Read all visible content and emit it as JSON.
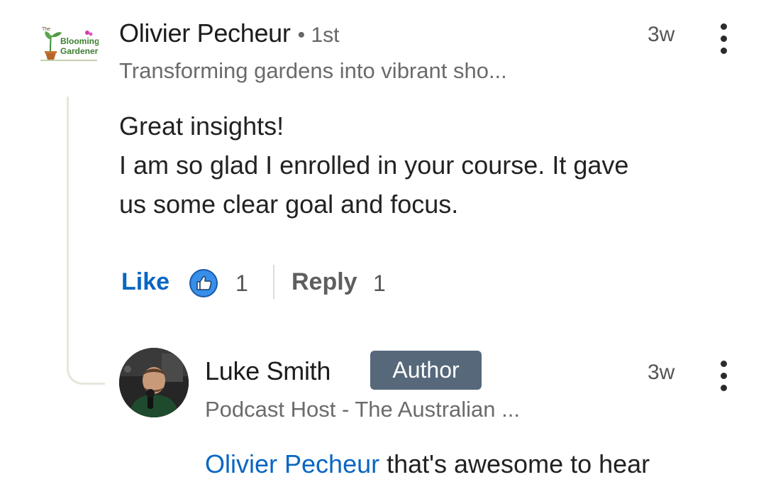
{
  "comment": {
    "author_name": "Olivier Pecheur",
    "connection": "• 1st",
    "time": "3w",
    "headline": "Transforming gardens into vibrant sho...",
    "body_line1": "Great insights!",
    "body_line2": "I am so glad I enrolled in your course. It gave",
    "body_line3": "us some clear goal and focus.",
    "avatar_logo": {
      "top_text": "The",
      "line1": "Blooming",
      "line2": "Gardeners"
    },
    "actions": {
      "like_label": "Like",
      "like_count": "1",
      "reply_label": "Reply",
      "reply_count": "1"
    }
  },
  "reply": {
    "author_name": "Luke Smith",
    "badge": "Author",
    "time": "3w",
    "headline": "Podcast Host - The Australian ...",
    "mention": "Olivier Pecheur",
    "body": " that's awesome to hear"
  },
  "colors": {
    "link": "#0a66c2",
    "badge_bg": "#56687a",
    "thread_line": "#e6e6dc",
    "like_icon": "#378fe9"
  },
  "icons": [
    "thumbs-up-icon",
    "more-options-icon"
  ]
}
